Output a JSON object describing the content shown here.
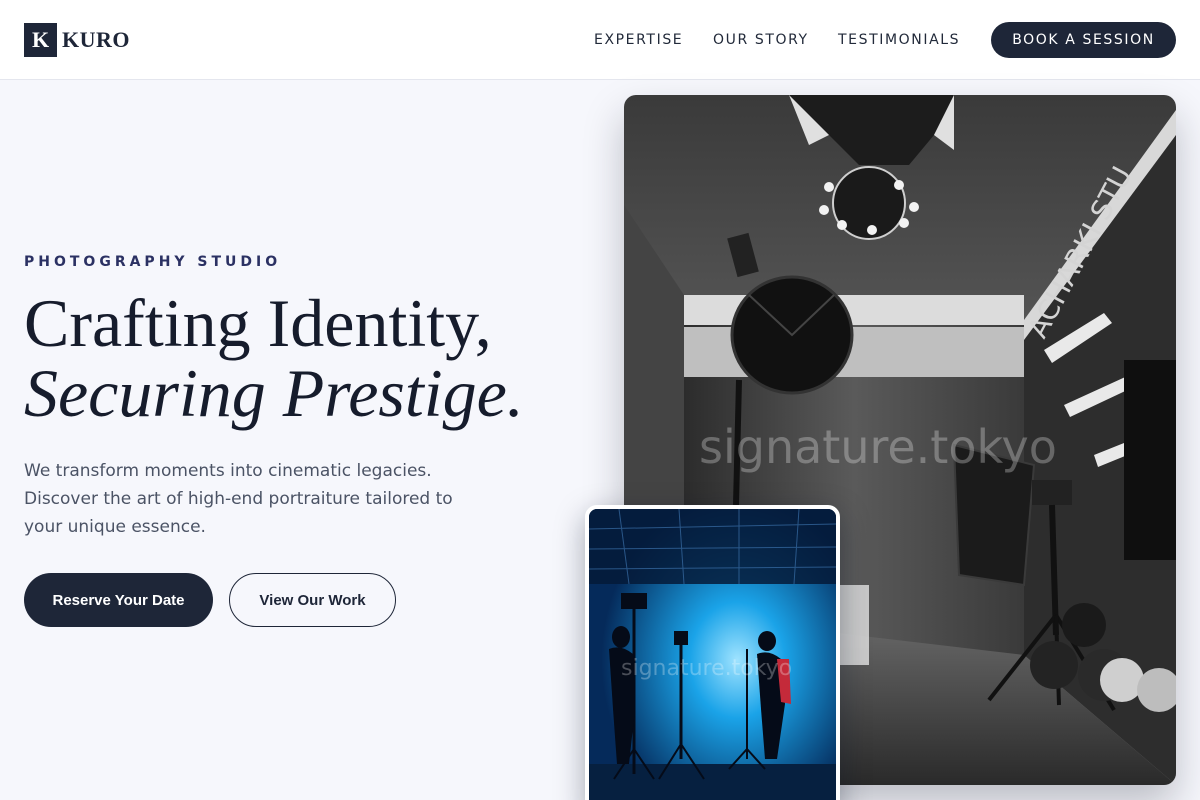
{
  "brand": {
    "mark": "K",
    "name": "KURO"
  },
  "nav": {
    "items": [
      "EXPERTISE",
      "OUR STORY",
      "TESTIMONIALS"
    ],
    "cta": "BOOK A SESSION"
  },
  "hero": {
    "eyebrow": "PHOTOGRAPHY STUDIO",
    "headline_line1": "Crafting Identity,",
    "headline_line2": "Securing Prestige.",
    "lede": "We transform moments into cinematic legacies. Discover the art of high-end portraiture tailored to your unique essence.",
    "primary_cta": "Reserve Your Date",
    "secondary_cta": "View Our Work"
  },
  "images": {
    "main_watermark": "signature.tokyo",
    "main_wall_sign": "ACHARKI STU",
    "inset_watermark": "signature.tokyo"
  },
  "colors": {
    "navy": "#1e2638",
    "background": "#f6f7fc",
    "eyebrow": "#2b3163",
    "studio_blue": "#1aa3e8"
  },
  "icons": {
    "logo": "kuro-logo-mark"
  }
}
